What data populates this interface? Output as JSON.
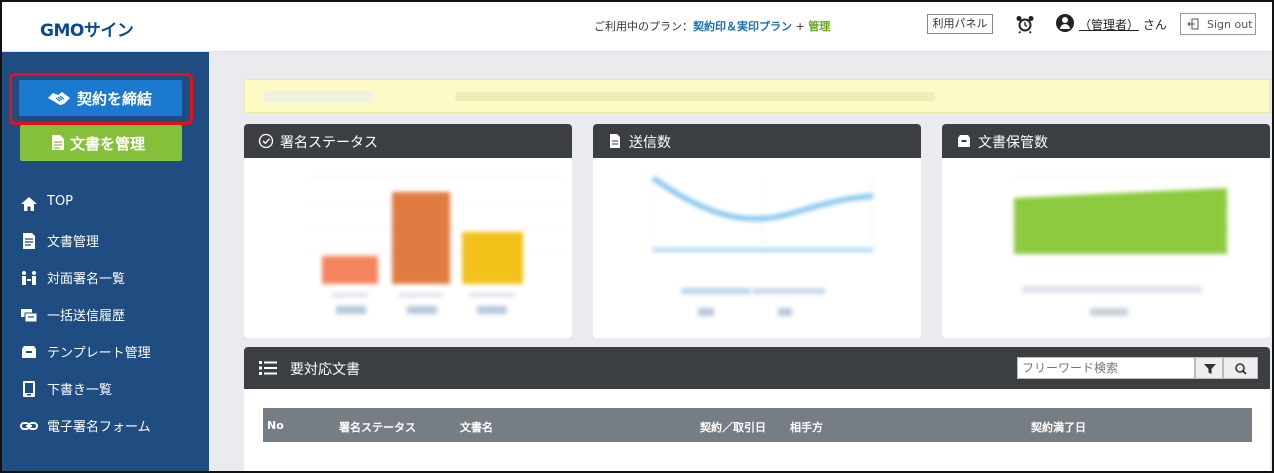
{
  "header": {
    "logo": "GMOサイン",
    "plan_prefix": "ご利用中のプラン：",
    "plan_name": "契約印＆実印プラン",
    "plan_plus": " + ",
    "plan_extra": "管理",
    "panel_button": "利用パネル",
    "user_name": "（管理者）",
    "user_suffix": " さん",
    "signout": "Sign out"
  },
  "sidebar": {
    "contract_button": "契約を締結",
    "manage_button": "文書を管理",
    "items": [
      {
        "label": "TOP",
        "icon": "home-icon"
      },
      {
        "label": "文書管理",
        "icon": "document-icon"
      },
      {
        "label": "対面署名一覧",
        "icon": "face-sign-icon"
      },
      {
        "label": "一括送信履歴",
        "icon": "bulk-send-icon"
      },
      {
        "label": "テンプレート管理",
        "icon": "template-icon"
      },
      {
        "label": "下書き一覧",
        "icon": "draft-icon"
      },
      {
        "label": "電子署名フォーム",
        "icon": "link-icon"
      }
    ]
  },
  "cards": {
    "status": {
      "title": "署名ステータス",
      "icon": "check-circle-icon"
    },
    "sent": {
      "title": "送信数",
      "icon": "file-icon"
    },
    "storage": {
      "title": "文書保管数",
      "icon": "archive-icon"
    }
  },
  "docs": {
    "title": "要対応文書",
    "icon": "list-icon",
    "search_placeholder": "フリーワード検索",
    "columns": [
      "No",
      "署名ステータス",
      "文書名",
      "契約／取引日",
      "相手方",
      "契約満了日"
    ]
  },
  "colors": {
    "sidebar_bg": "#1f4d82",
    "contract_button": "#1b79d0",
    "manage_button": "#86c03a",
    "card_header": "#3b3f44",
    "highlight_outline": "#e4111b"
  }
}
